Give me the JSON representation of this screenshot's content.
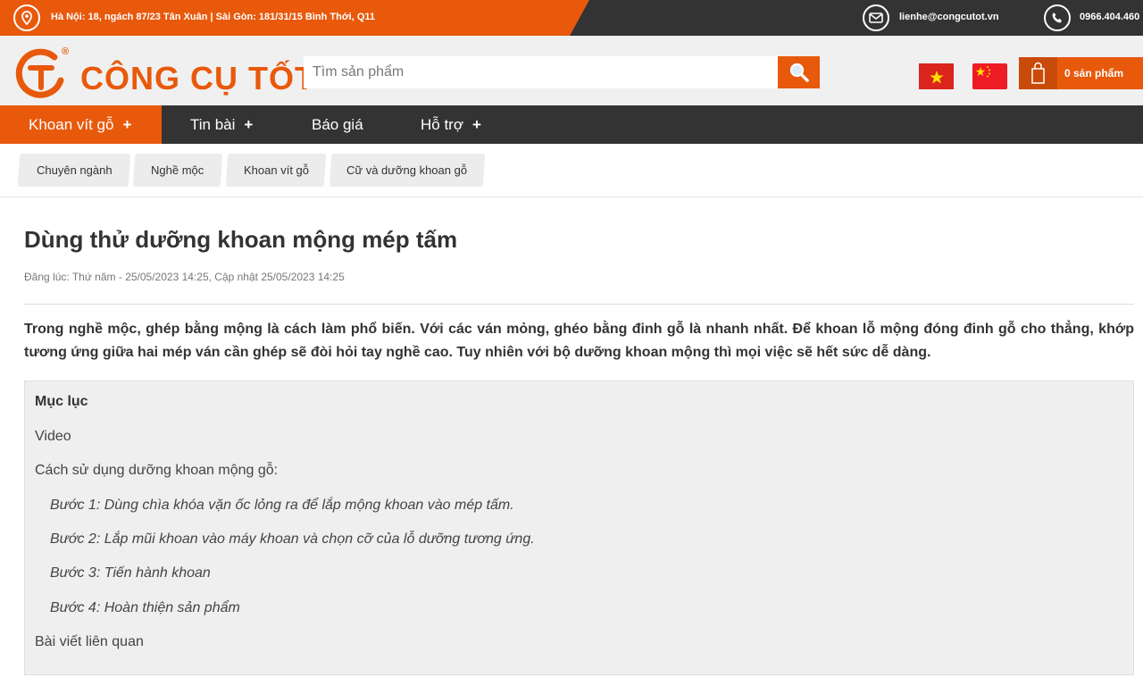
{
  "topbar": {
    "address": "Hà Nội: 18, ngách 87/23 Tân Xuân | Sài Gòn: 181/31/15 Bình Thới, Q11",
    "email": "lienhe@congcutot.vn",
    "phone": "0966.404.460"
  },
  "header": {
    "logo_text": "CÔNG CỤ TỐT",
    "logo_mark": "®",
    "search_placeholder": "Tìm sản phẩm",
    "cart_label": "0 sản phẩm"
  },
  "nav": {
    "items": [
      {
        "label": "Khoan vít gỗ",
        "plus": "+"
      },
      {
        "label": "Tin bài",
        "plus": "+"
      },
      {
        "label": "Báo giá"
      },
      {
        "label": "Hỗ trợ",
        "plus": "+"
      }
    ]
  },
  "breadcrumb": [
    "Chuyên ngành",
    "Nghề mộc",
    "Khoan vít gỗ",
    "Cữ và dưỡng khoan gỗ"
  ],
  "article": {
    "title": "Dùng thử dưỡng khoan mộng mép tấm",
    "meta": "Đăng lúc: Thứ năm - 25/05/2023 14:25, Cập nhật 25/05/2023 14:25",
    "lead": "Trong nghề mộc, ghép bằng mộng là cách làm phổ biến. Với các ván mỏng, ghéo bằng đinh gỗ là nhanh nhất. Để khoan lỗ mộng đóng đinh gỗ cho thẳng, khớp tương ứng giữa hai mép ván cần ghép sẽ đòi hỏi tay nghề cao. Tuy nhiên với bộ dưỡng khoan mộng thì mọi việc sẽ hết sức dễ dàng."
  },
  "toc": {
    "title": "Mục lục",
    "items": [
      "Video",
      "Cách sử dụng dưỡng khoan mộng gỗ:",
      "Bước 1: Dùng chìa khóa vặn ốc lỏng ra để lắp mộng khoan vào mép tấm.",
      "Bước 2: Lắp mũi khoan vào máy khoan và chọn cỡ của lỗ dưỡng tương ứng.",
      "Bước 3: Tiến hành khoan",
      "Bước 4: Hoàn thiện sản phẩm",
      "Bài viết liên quan"
    ]
  },
  "colors": {
    "accent": "#e8590c",
    "dark": "#333333"
  },
  "icons": [
    "map-pin-icon",
    "mail-icon",
    "phone-icon",
    "search-icon",
    "cart-icon",
    "flag-vn-icon",
    "flag-cn-icon"
  ]
}
